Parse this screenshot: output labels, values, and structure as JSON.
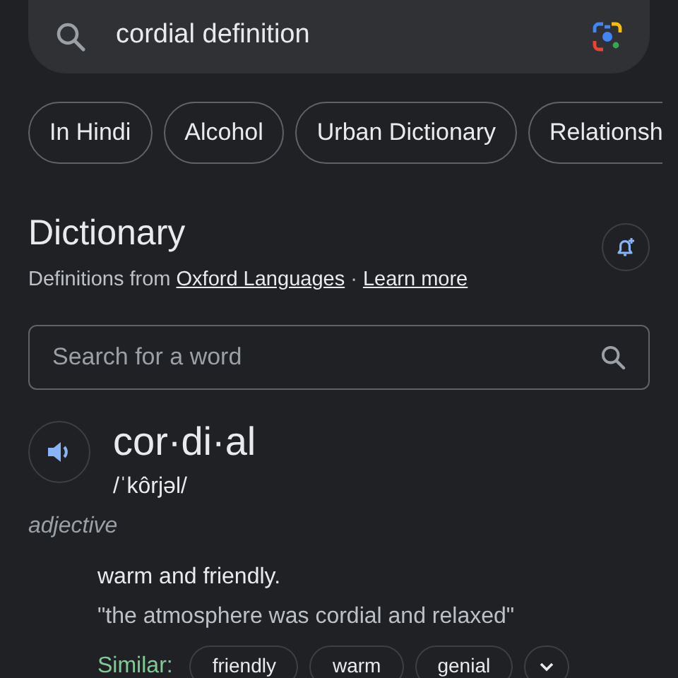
{
  "search_bar": {
    "query": "cordial definition"
  },
  "chips": [
    {
      "label": "In Hindi"
    },
    {
      "label": "Alcohol"
    },
    {
      "label": "Urban Dictionary"
    },
    {
      "label": "Relationsh"
    }
  ],
  "dictionary": {
    "title": "Dictionary",
    "source_prefix": "Definitions from",
    "source_link": "Oxford Languages",
    "separator": "·",
    "learn_more": "Learn more",
    "word_search": {
      "placeholder": "Search for a word"
    },
    "headword": "cor·di·al",
    "pronunciation": "/ˈkôrjəl/",
    "part_of_speech": "adjective",
    "definition": "warm and friendly.",
    "example": "\"the atmosphere was cordial and relaxed\"",
    "similar_label": "Similar:",
    "similar": [
      "friendly",
      "warm",
      "genial"
    ]
  }
}
